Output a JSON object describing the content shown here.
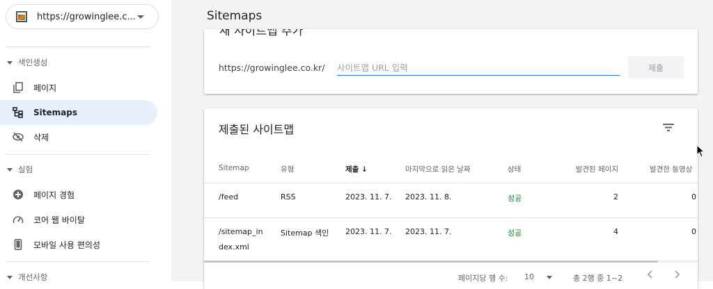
{
  "property": {
    "url": "https://growinglee.c..."
  },
  "sidebar": {
    "sections": [
      {
        "label": "색인생성",
        "items": [
          {
            "label": "페이지",
            "icon": "pages-icon"
          },
          {
            "label": "Sitemaps",
            "icon": "sitemap-icon",
            "active": true
          },
          {
            "label": "삭제",
            "icon": "removals-icon"
          }
        ]
      },
      {
        "label": "실험",
        "items": [
          {
            "label": "페이지 경험",
            "icon": "page-experience-icon"
          },
          {
            "label": "코어 웹 바이탈",
            "icon": "speedometer-icon"
          },
          {
            "label": "모바일 사용 편의성",
            "icon": "mobile-icon"
          }
        ]
      },
      {
        "label": "개선사항"
      }
    ]
  },
  "header": {
    "title": "Sitemaps"
  },
  "add_card": {
    "heading_partial": "새 사이트맵 추가",
    "url_prefix": "https://growinglee.co.kr/",
    "input_placeholder": "사이트맵 URL 입력",
    "submit_label": "제출"
  },
  "submitted_card": {
    "title": "제출된 사이트맵",
    "columns": [
      "Sitemap",
      "유형",
      "제출",
      "마지막으로 읽은 날짜",
      "상태",
      "발견된 페이지",
      "발견한 동영상"
    ],
    "sort_arrow": "↓",
    "rows": [
      {
        "sitemap": "/feed",
        "type": "RSS",
        "submitted": "2023. 11. 7.",
        "last_read": "2023. 11. 8.",
        "status": "성공",
        "pages": "2",
        "videos": "0"
      },
      {
        "sitemap_line1": "/sitemap_in",
        "sitemap_line2": "dex.xml",
        "type": "Sitemap 색인",
        "submitted": "2023. 11. 7.",
        "last_read": "2023. 11. 7.",
        "status": "성공",
        "pages": "4",
        "videos": "0"
      }
    ],
    "pager": {
      "rows_per_page_label": "페이지당 행 수:",
      "rows_per_page": "10",
      "range": "총 2행 중 1~2"
    }
  },
  "colors": {
    "accent": "#1a73e8",
    "active_nav_bg": "#e8f0fe",
    "success": "#188038",
    "page_bg": "#f1f3f4"
  }
}
